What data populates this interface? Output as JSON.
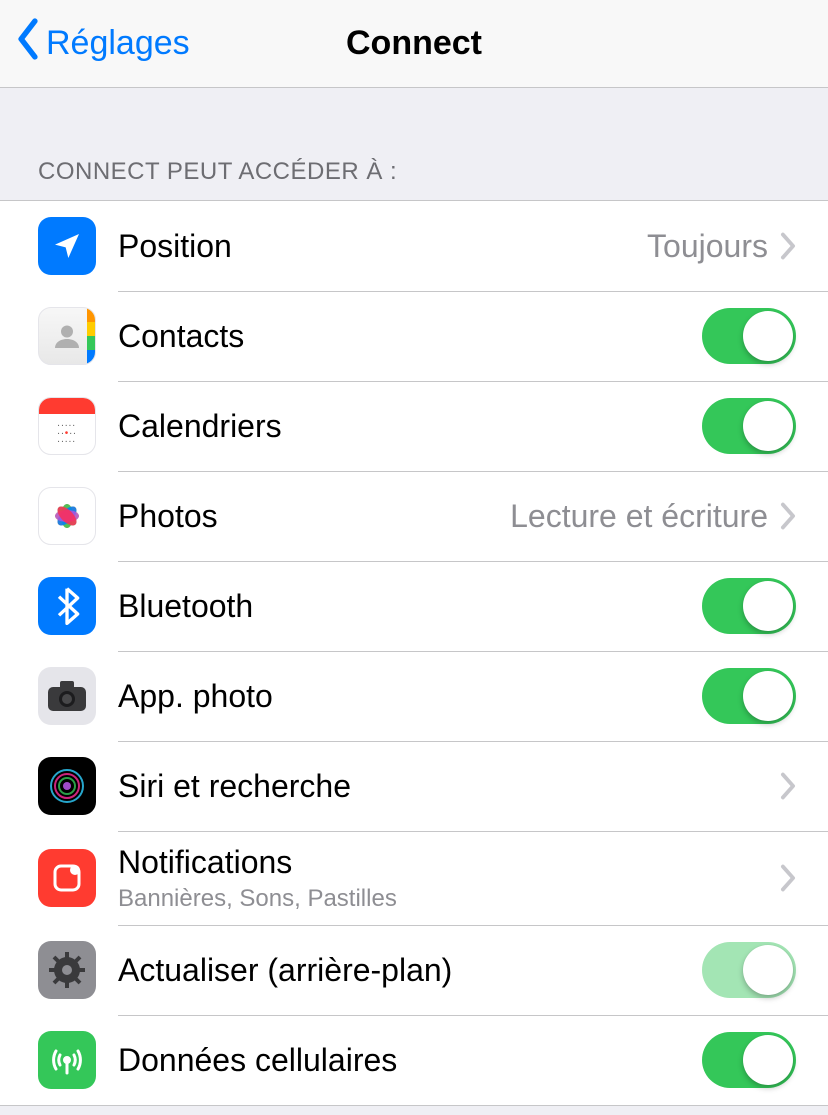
{
  "nav": {
    "back_label": "Réglages",
    "title": "Connect"
  },
  "section": {
    "header": "Connect peut accéder à :"
  },
  "rows": {
    "position": {
      "label": "Position",
      "value": "Toujours"
    },
    "contacts": {
      "label": "Contacts"
    },
    "calendars": {
      "label": "Calendriers"
    },
    "photos": {
      "label": "Photos",
      "value": "Lecture et écriture"
    },
    "bluetooth": {
      "label": "Bluetooth"
    },
    "camera": {
      "label": "App. photo"
    },
    "siri": {
      "label": "Siri et recherche"
    },
    "notifications": {
      "label": "Notifications",
      "subtitle": "Bannières, Sons, Pastilles"
    },
    "background_refresh": {
      "label": "Actualiser (arrière-plan)"
    },
    "cellular": {
      "label": "Données cellulaires"
    }
  }
}
